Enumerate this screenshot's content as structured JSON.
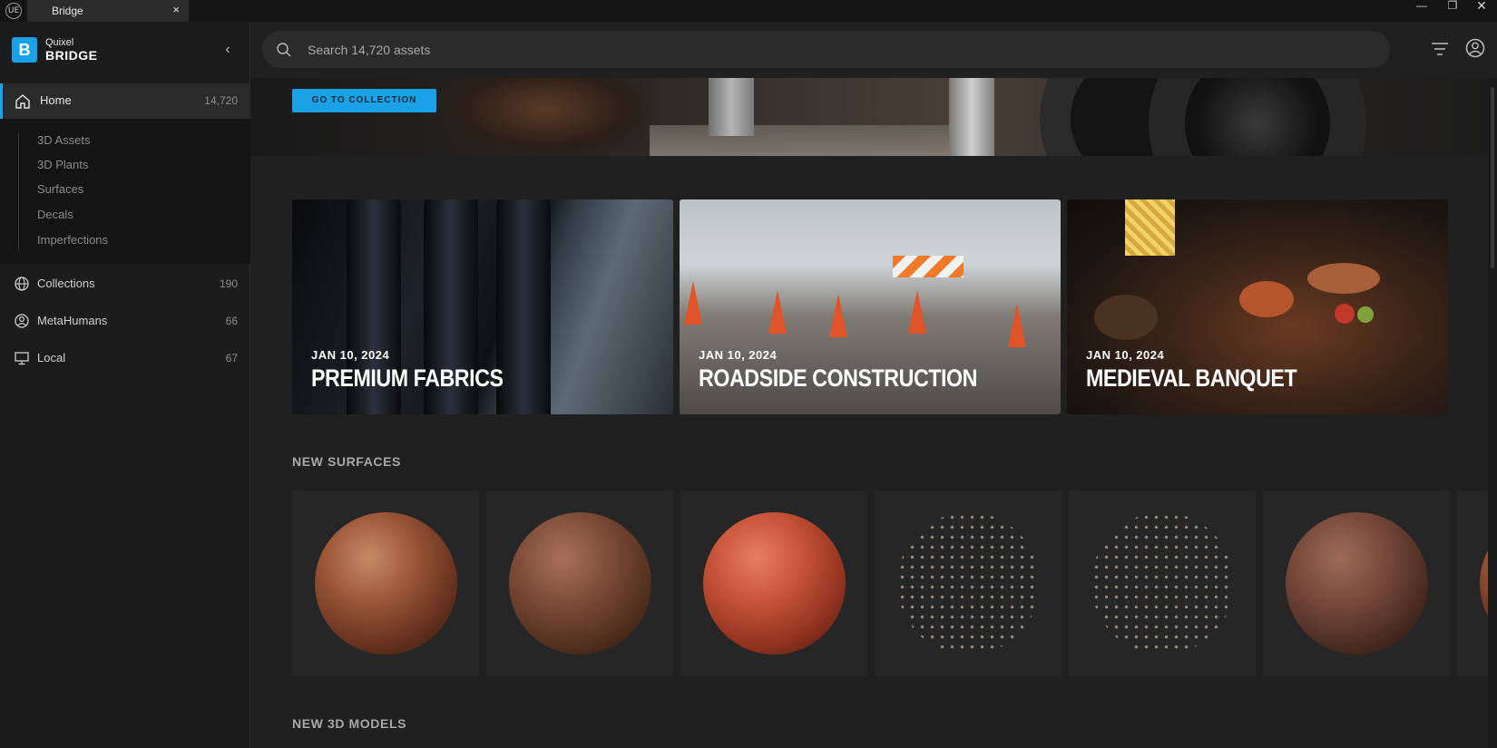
{
  "window": {
    "app_icon": "UE",
    "tab_title": "Bridge",
    "tab_close": "×",
    "minimize": "—",
    "maximize": "❐",
    "close": "✕"
  },
  "sidebar": {
    "brand_line1": "Quixel",
    "brand_line2": "BRIDGE",
    "brand_logo": "B",
    "collapse": "‹",
    "home": {
      "label": "Home",
      "count": "14,720",
      "icon": "home-icon"
    },
    "sub_items": [
      {
        "label": "3D Assets"
      },
      {
        "label": "3D Plants"
      },
      {
        "label": "Surfaces"
      },
      {
        "label": "Decals"
      },
      {
        "label": "Imperfections"
      }
    ],
    "items": [
      {
        "label": "Collections",
        "count": "190",
        "icon": "globe-icon"
      },
      {
        "label": "MetaHumans",
        "count": "66",
        "icon": "user-circle-icon"
      },
      {
        "label": "Local",
        "count": "67",
        "icon": "monitor-icon"
      }
    ]
  },
  "search": {
    "placeholder": "Search 14,720 assets",
    "value": ""
  },
  "hero": {
    "button_label": "GO TO COLLECTION"
  },
  "featured": [
    {
      "date": "JAN 10, 2024",
      "title": "PREMIUM FABRICS"
    },
    {
      "date": "JAN 10, 2024",
      "title": "ROADSIDE CONSTRUCTION"
    },
    {
      "date": "JAN 10, 2024",
      "title": "MEDIEVAL BANQUET"
    }
  ],
  "sections": {
    "new_surfaces": "NEW SURFACES",
    "new_3d_models": "NEW 3D MODELS"
  },
  "colors": {
    "accent": "#1ba2e6",
    "background": "#202020",
    "sidebar": "#1c1c1c"
  }
}
